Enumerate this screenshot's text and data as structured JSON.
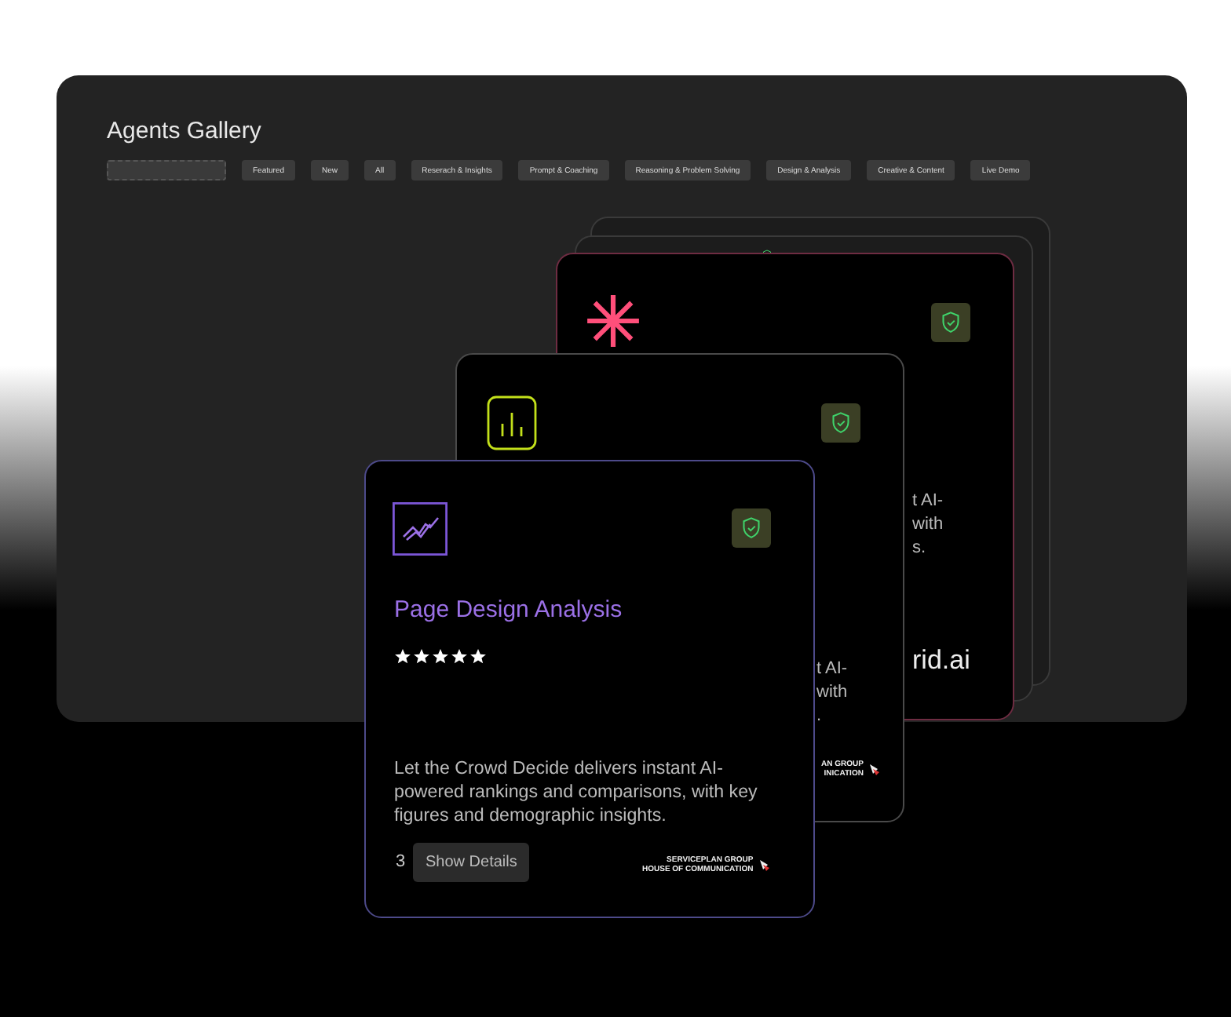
{
  "gallery": {
    "title": "Agents Gallery",
    "filters": [
      {
        "label": "Featured",
        "selected": false
      },
      {
        "label": "New",
        "selected": false
      },
      {
        "label": "All",
        "selected": false
      },
      {
        "label": "Reserach & Insights",
        "selected": false
      },
      {
        "label": "Prompt & Coaching",
        "selected": false
      },
      {
        "label": "Reasoning & Problem Solving",
        "selected": false
      },
      {
        "label": "Design & Analysis",
        "selected": false
      },
      {
        "label": "Creative & Content",
        "selected": false
      },
      {
        "label": "Live Demo",
        "selected": false
      }
    ],
    "cards": [
      {
        "kind": "back",
        "color": "#3a3a3a"
      },
      {
        "kind": "back-shield",
        "color": "#3a3a3a"
      },
      {
        "kind": "asterisk",
        "color": "#6e2c42",
        "text_lines": [
          "t AI-",
          "with",
          "s."
        ],
        "brand": "rid.ai"
      },
      {
        "kind": "chart",
        "color": "#4a4a4a",
        "text_lines": [
          "t AI-",
          "with",
          "."
        ],
        "logo_lines": [
          "AN GROUP",
          "INICATION"
        ]
      },
      {
        "kind": "trend",
        "color": "#4d4a8a",
        "title": "Page Design Analysis",
        "stars": 5,
        "description": "Let the Crowd Decide delivers instant AI-powered rankings and comparisons, with key figures and demographic insights.",
        "count": "3",
        "button": "Show Details",
        "logo_lines": [
          "SERVICEPLAN GROUP",
          "HOUSE OF COMMUNICATION"
        ]
      }
    ]
  }
}
